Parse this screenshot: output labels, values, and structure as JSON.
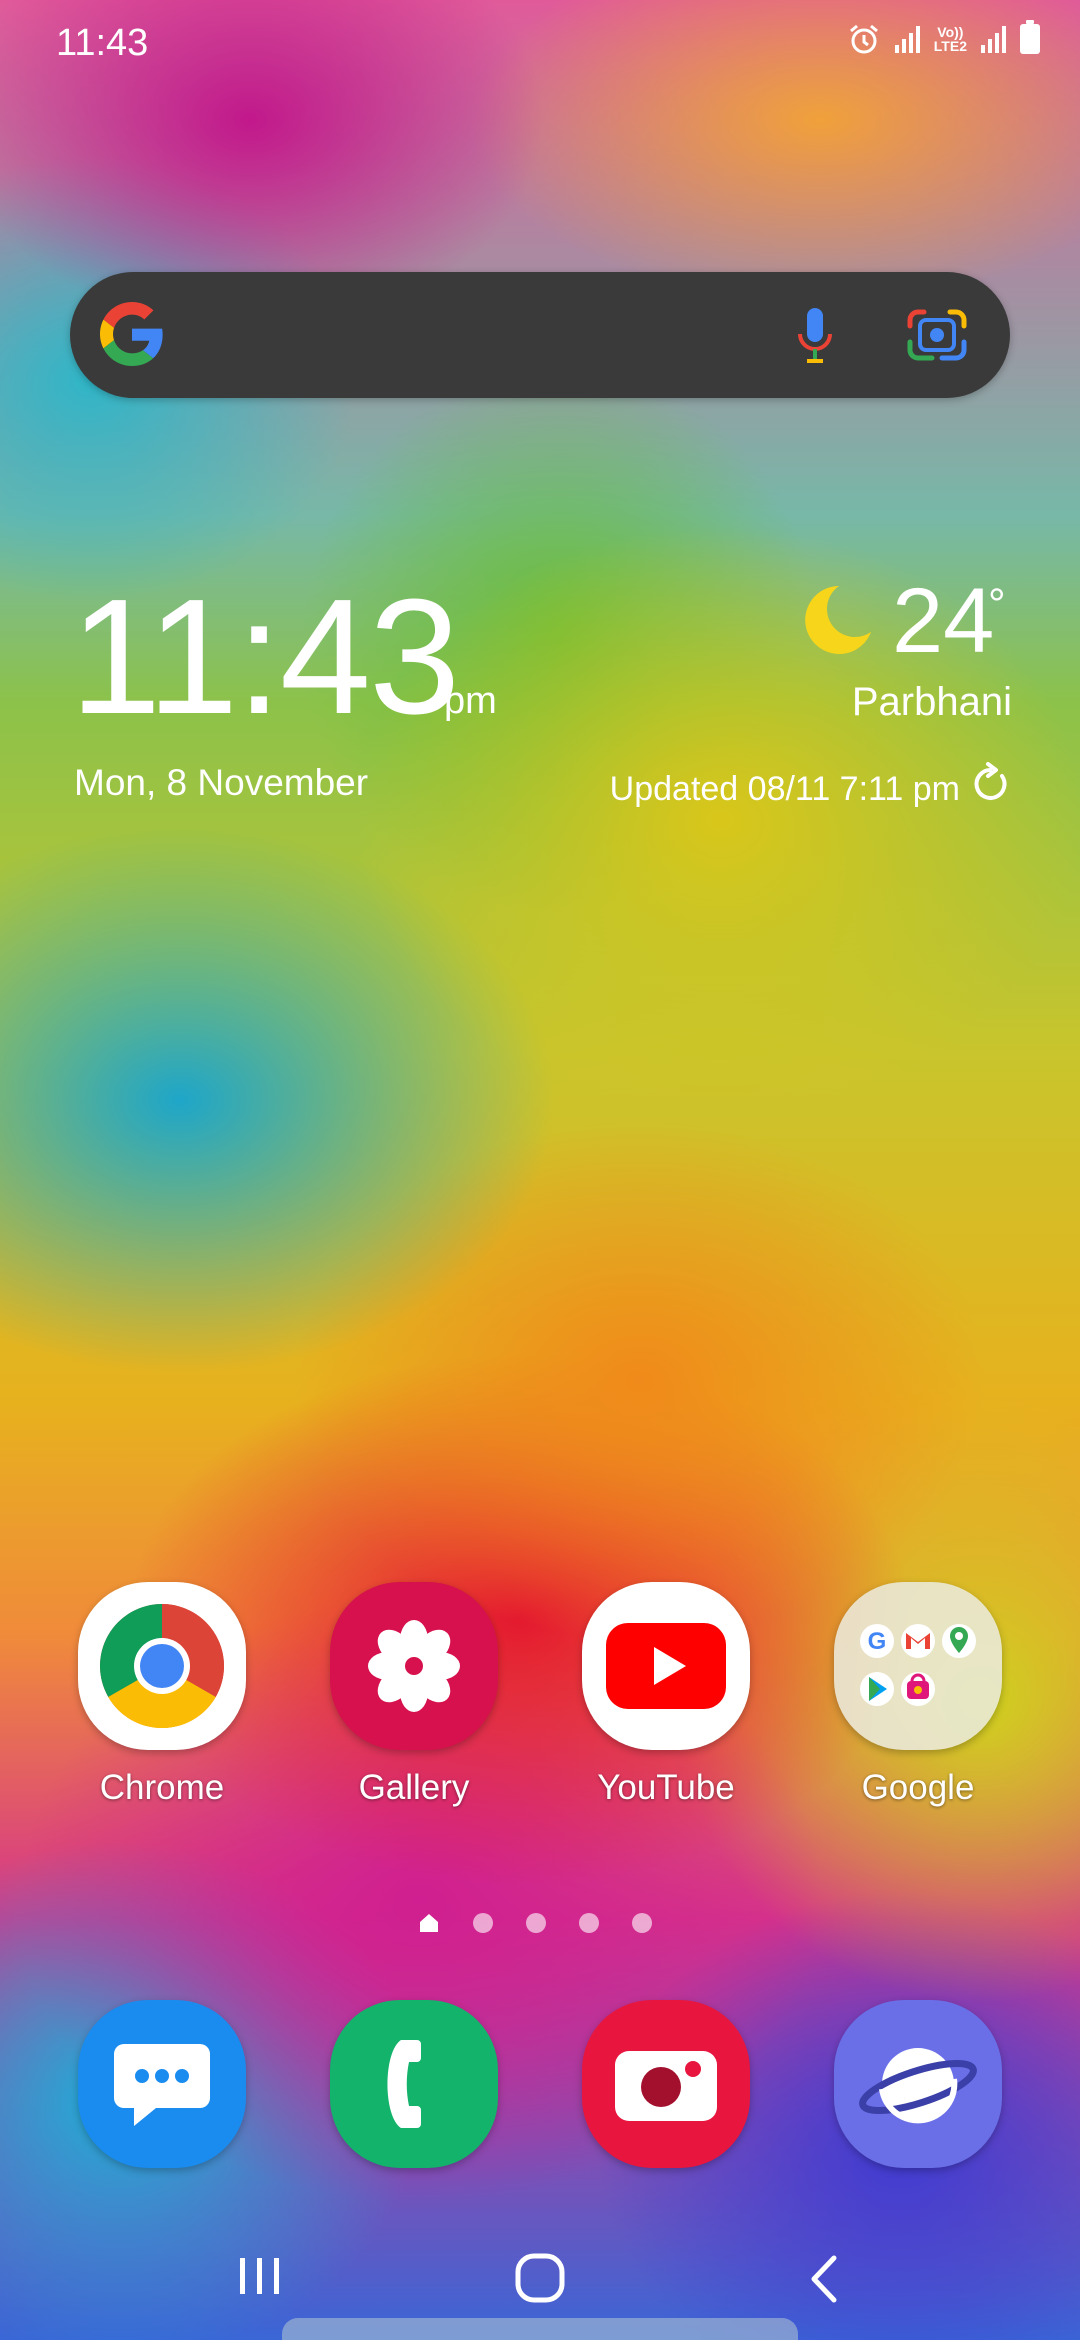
{
  "status_bar": {
    "time": "11:43",
    "volte_top": "Vo))",
    "volte_bottom": "LTE2",
    "icons": [
      "alarm-icon",
      "signal-icon",
      "volte-icon",
      "signal-icon",
      "battery-icon"
    ]
  },
  "search_widget": {
    "icons": [
      "google-logo-icon",
      "microphone-icon",
      "google-lens-icon"
    ]
  },
  "clock_widget": {
    "time": "11:43",
    "ampm": "pm",
    "date": "Mon, 8 November"
  },
  "weather_widget": {
    "temperature": "24",
    "degree_symbol": "°",
    "city": "Parbhani",
    "updated": "Updated 08/11 7:11 pm",
    "icon": "moon-icon"
  },
  "home_apps": [
    {
      "label": "Chrome",
      "icon": "chrome-icon"
    },
    {
      "label": "Gallery",
      "icon": "gallery-icon"
    },
    {
      "label": "YouTube",
      "icon": "youtube-icon"
    },
    {
      "label": "Google",
      "icon": "google-folder-icon"
    }
  ],
  "page_indicator": {
    "pages": 5,
    "current": 1
  },
  "dock_apps": [
    {
      "name": "Messages",
      "icon": "messages-icon",
      "color": "#1a8cf0"
    },
    {
      "name": "Phone",
      "icon": "phone-icon",
      "color": "#14b36b"
    },
    {
      "name": "Camera",
      "icon": "camera-icon",
      "color": "#e8163f"
    },
    {
      "name": "Internet",
      "icon": "internet-icon",
      "color": "#6a6fe8"
    }
  ],
  "navigation": {
    "icons": [
      "recent-apps-icon",
      "home-icon",
      "back-icon"
    ]
  }
}
